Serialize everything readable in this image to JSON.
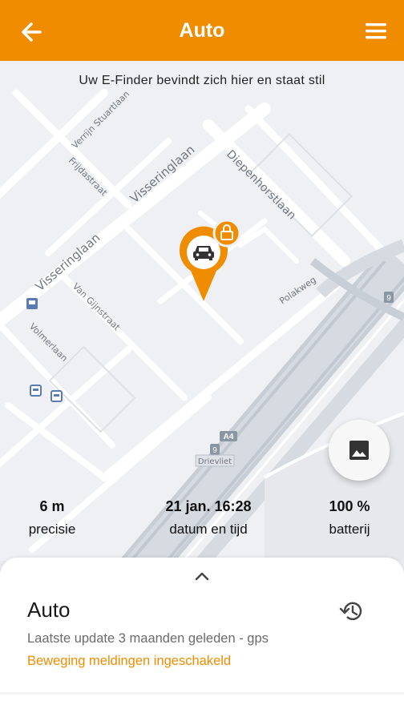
{
  "header": {
    "title": "Auto",
    "back_icon": "arrow-left-icon",
    "menu_icon": "hamburger-menu-icon",
    "color": "#f08c00"
  },
  "map": {
    "message": "Uw E-Finder bevindt zich hier en staat stil",
    "streets": {
      "verrijn_stuart": "Verrijn Stuartlaan",
      "frijdastraat": "Frijdastraat",
      "visseringlaan_1": "Visseringlaan",
      "visseringlaan_2": "Visseringlaan",
      "diepenhorstlaan": "Diepenhorstlaan",
      "van_gijnstraat": "Van Gijnstraat",
      "volmerlaan": "Volmerlaan",
      "polakweg": "Polakweg",
      "shield_a4": "A4",
      "shield_9a": "9",
      "shield_9b": "9",
      "place": "Drievliet"
    },
    "marker_icon": "car-icon",
    "lock_icon": "lock-icon"
  },
  "photo_button": {
    "icon": "image-icon"
  },
  "stats": {
    "precision_value": "6 m",
    "precision_label": "precisie",
    "datetime_value": "21 jan. 16:28",
    "datetime_label": "datum en tijd",
    "battery_value": "100 %",
    "battery_label": "batterij"
  },
  "sheet": {
    "expand_icon": "chevron-up-icon",
    "name": "Auto",
    "history_icon": "history-icon",
    "last_update": "Laatste update 3 maanden geleden - gps",
    "motion_alerts": "Beweging meldingen ingeschakeld",
    "accent": "#f08c00"
  }
}
